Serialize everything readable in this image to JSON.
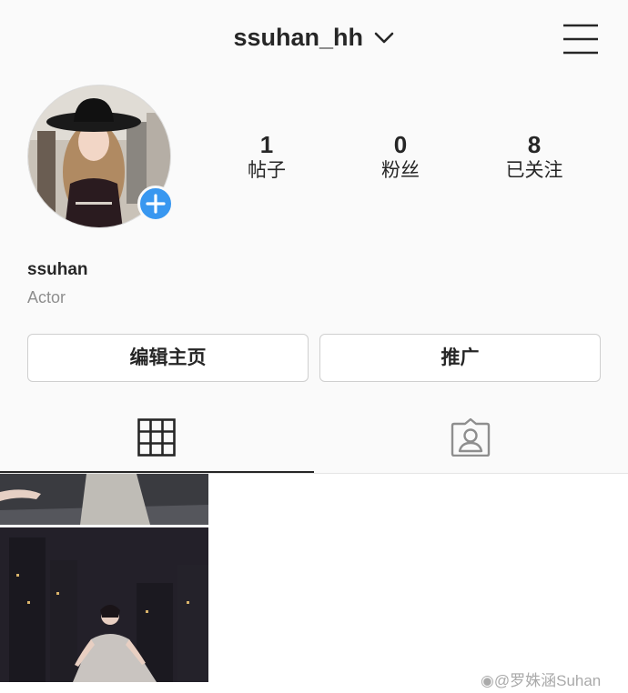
{
  "header": {
    "username": "ssuhan_hh",
    "chevron_icon": "chevron-down-icon",
    "menu_icon": "hamburger-menu-icon"
  },
  "profile": {
    "avatar_icon": "profile-photo",
    "add_story_icon": "plus-icon",
    "add_story_color": "#3897f0",
    "display_name": "ssuhan",
    "bio": "Actor"
  },
  "stats": [
    {
      "count": "1",
      "label": "帖子"
    },
    {
      "count": "0",
      "label": "粉丝"
    },
    {
      "count": "8",
      "label": "已关注"
    }
  ],
  "buttons": {
    "edit_profile": "编辑主页",
    "promote": "推广"
  },
  "tabs": [
    {
      "icon": "grid-icon",
      "active": true
    },
    {
      "icon": "tagged-icon",
      "active": false
    }
  ],
  "posts": [
    {
      "icon": "post-photo"
    }
  ],
  "watermark": {
    "icon": "weibo-icon",
    "text": "@罗姝涵Suhan"
  }
}
